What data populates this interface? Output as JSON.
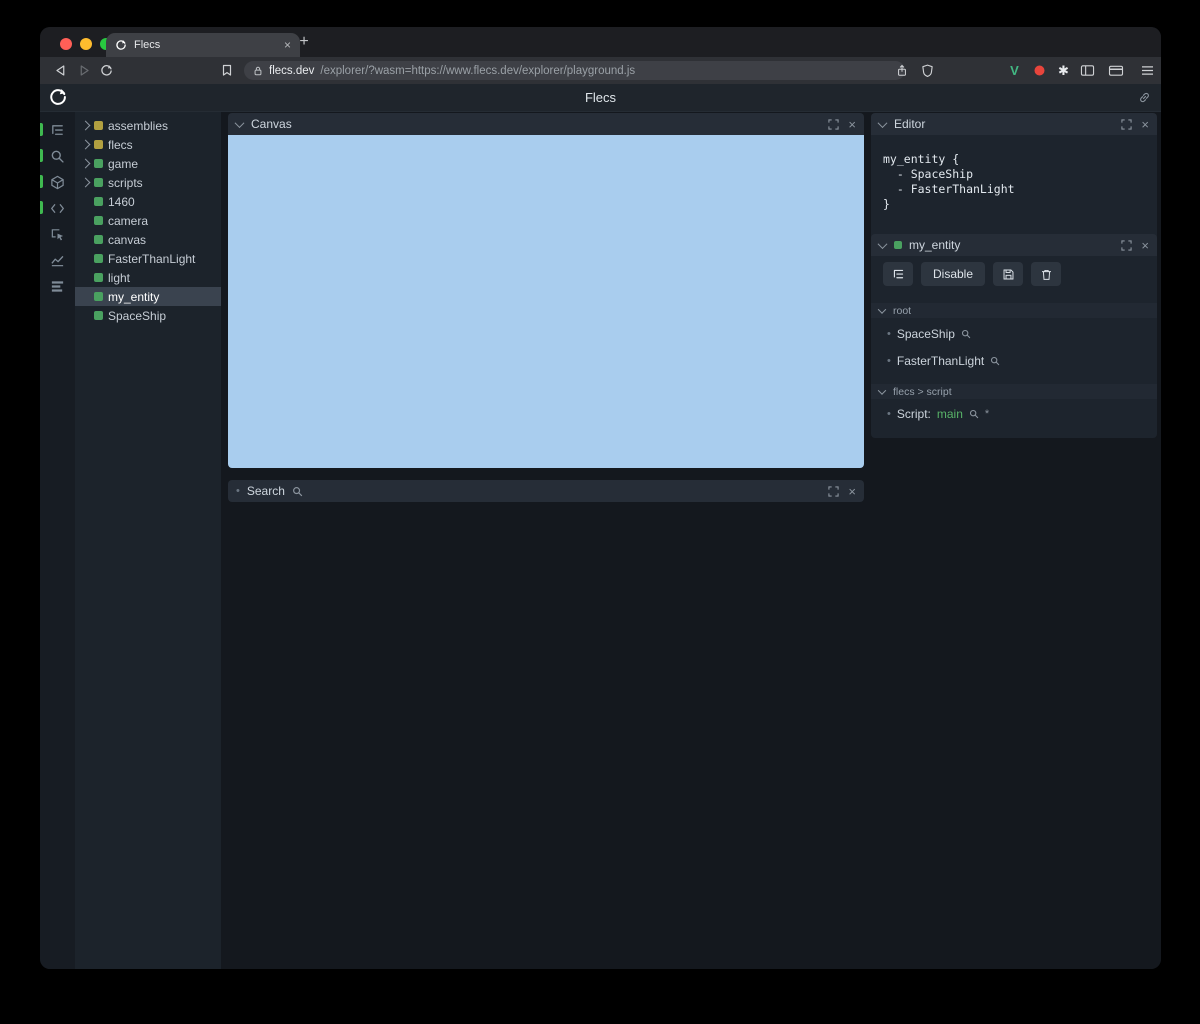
{
  "colors": {
    "main-bg": "#14181e",
    "chrome-tab-strip": "#1d1e22",
    "chrome-active-tab": "#3e4045",
    "chrome-navbar": "#2f3136",
    "chrome-pill": "#3e4046",
    "app-header": "#1f252c",
    "iconbar": "#171c23",
    "tree-bg": "#1c232b",
    "tree-selected": "#3a434f",
    "panel-header": "#262d37",
    "panel-body": "#1d242d",
    "section-header": "#222933",
    "button": "#2d353f",
    "canvas-blue": "#a9cdee",
    "entity-green": "#4aa160",
    "module-yellow": "#b2a040",
    "accent-green": "#3fb950",
    "green-text": "#58b368",
    "light-red": "#ff5f57",
    "light-yellow": "#febc2e",
    "light-green": "#28c840"
  },
  "icons": {
    "close": "×",
    "plus": "+",
    "bullet": "•",
    "asterisk": "*"
  },
  "browser": {
    "tab_title": "Flecs",
    "url_domain": "flecs.dev",
    "url_path": "/explorer/?wasm=https://www.flecs.dev/explorer/playground.js"
  },
  "app": {
    "title": "Flecs",
    "tree": {
      "items": [
        {
          "label": "assemblies",
          "kind": "module",
          "expandable": true
        },
        {
          "label": "flecs",
          "kind": "module",
          "expandable": true
        },
        {
          "label": "game",
          "kind": "entity",
          "expandable": true
        },
        {
          "label": "scripts",
          "kind": "entity",
          "expandable": true
        },
        {
          "label": "1460",
          "kind": "entity",
          "expandable": false
        },
        {
          "label": "camera",
          "kind": "entity",
          "expandable": false
        },
        {
          "label": "canvas",
          "kind": "entity",
          "expandable": false
        },
        {
          "label": "FasterThanLight",
          "kind": "entity",
          "expandable": false
        },
        {
          "label": "light",
          "kind": "entity",
          "expandable": false
        },
        {
          "label": "my_entity",
          "kind": "entity",
          "expandable": false,
          "selected": true
        },
        {
          "label": "SpaceShip",
          "kind": "entity",
          "expandable": false
        }
      ]
    },
    "panels": {
      "canvas": {
        "title": "Canvas"
      },
      "search": {
        "title": "Search"
      },
      "editor": {
        "title": "Editor",
        "code": [
          "my_entity {",
          "  - SpaceShip",
          "  - FasterThanLight",
          "}"
        ]
      },
      "entity": {
        "title": "my_entity",
        "disable_label": "Disable",
        "sections": [
          {
            "title": "root"
          },
          {
            "title": "flecs > script"
          }
        ],
        "root_items": [
          "SpaceShip",
          "FasterThanLight"
        ],
        "script_item": {
          "label": "Script:",
          "value": "main"
        }
      }
    }
  }
}
